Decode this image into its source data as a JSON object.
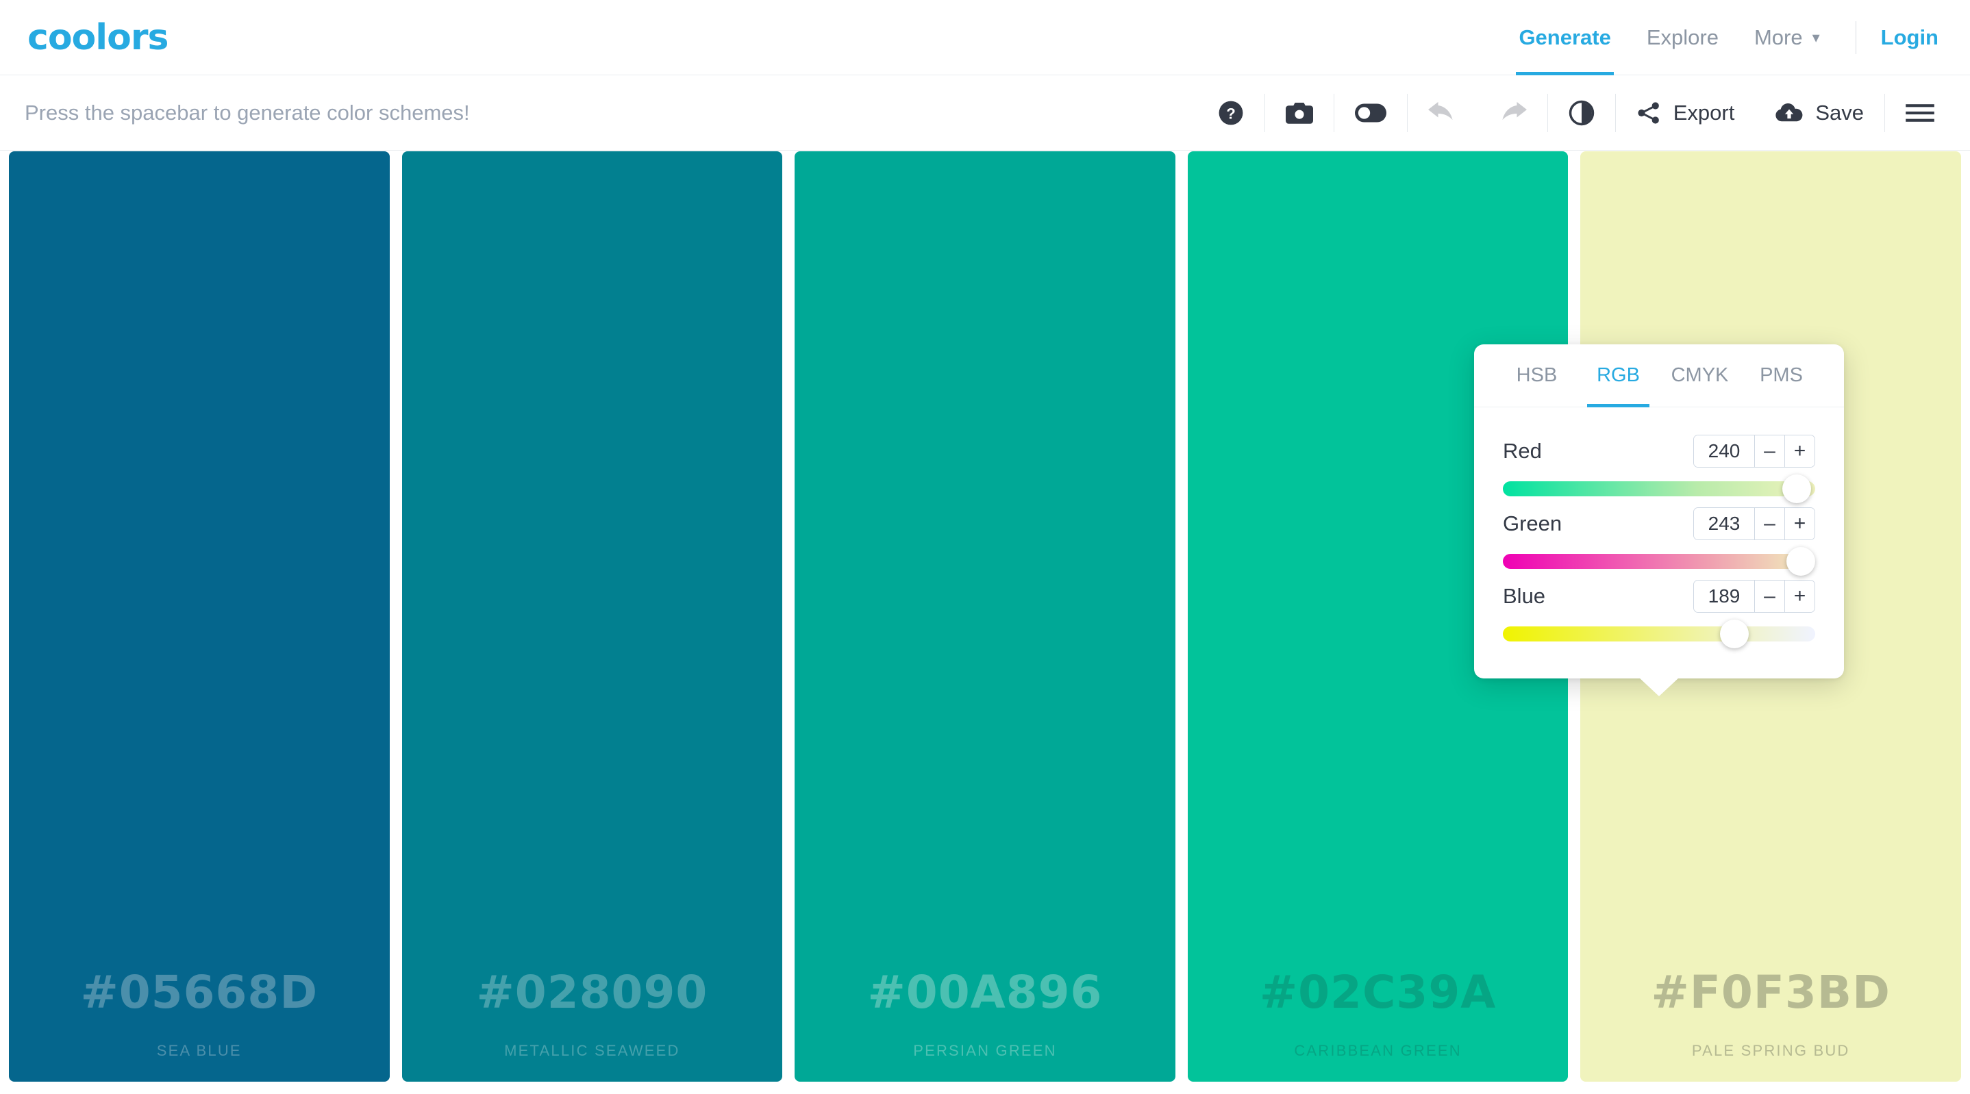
{
  "brand": {
    "logo_text": "coolors",
    "logo_color": "#27AAE1"
  },
  "nav": {
    "items": [
      {
        "label": "Generate",
        "active": true
      },
      {
        "label": "Explore",
        "active": false
      },
      {
        "label": "More",
        "active": false,
        "caret": "▾"
      }
    ],
    "login_label": "Login"
  },
  "toolbar": {
    "hint": "Press the spacebar to generate color schemes!",
    "export_label": "Export",
    "save_label": "Save",
    "icons": [
      "help-circle-icon",
      "camera-icon",
      "toggle-switch-icon",
      "undo-icon",
      "redo-icon",
      "contrast-icon",
      "share-icon",
      "cloud-upload-icon",
      "hamburger-menu-icon"
    ]
  },
  "palette": {
    "swatches": [
      {
        "hex": "#05668D",
        "name": "SEA BLUE",
        "bg": "#05668D",
        "text": "#4B8FAB",
        "sub": "#4B8FAB",
        "has_adjust": false
      },
      {
        "hex": "#028090",
        "name": "METALLIC SEAWEED",
        "bg": "#028090",
        "text": "#45A1AC",
        "sub": "#45A1AC",
        "has_adjust": false
      },
      {
        "hex": "#00A896",
        "name": "PERSIAN GREEN",
        "bg": "#00A896",
        "text": "#4CC0B2",
        "sub": "#4CC0B2",
        "has_adjust": false
      },
      {
        "hex": "#02C39A",
        "name": "CARIBBEAN GREEN",
        "bg": "#02C39A",
        "text": "#06A584",
        "sub": "#06A584",
        "has_adjust": false
      },
      {
        "hex": "#F0F3BD",
        "name": "PALE SPRING BUD",
        "bg": "#F0F3BD",
        "text": "#B6BA92",
        "sub": "#B6BA92",
        "has_adjust": true
      }
    ]
  },
  "picker": {
    "tabs": [
      {
        "label": "HSB",
        "active": false
      },
      {
        "label": "RGB",
        "active": true
      },
      {
        "label": "CMYK",
        "active": false
      },
      {
        "label": "PMS",
        "active": false
      }
    ],
    "channels": [
      {
        "label": "Red",
        "value": "240",
        "percent": 94.1,
        "minus": "–",
        "plus": "+"
      },
      {
        "label": "Green",
        "value": "243",
        "percent": 95.3,
        "minus": "–",
        "plus": "+"
      },
      {
        "label": "Blue",
        "value": "189",
        "percent": 74.1,
        "minus": "–",
        "plus": "+"
      }
    ]
  }
}
